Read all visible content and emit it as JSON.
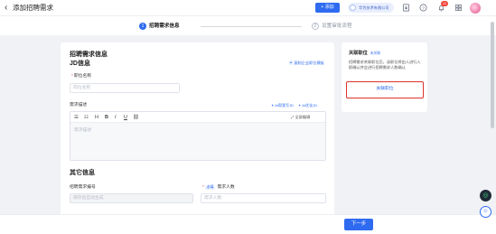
{
  "header": {
    "back_icon": "chevron-left-icon",
    "title": "添加招聘需求",
    "add_button": "+ 添加",
    "user_pill": "华为技术有限公司",
    "notification_count": "11"
  },
  "steps": [
    {
      "number": "1",
      "label": "招聘需求信息"
    },
    {
      "number": "2",
      "label": "设置审批流程"
    }
  ],
  "form": {
    "section_title": "招聘需求信息",
    "jd_title": "JD信息",
    "copy_link": "复制企业职位模板",
    "position_label": "职位名称",
    "position_placeholder": "岗位名称",
    "desc_label": "需求描述",
    "ai_generate": "AI帮我写JD",
    "optimize": "AI优化JD",
    "fullscreen": "全屏编辑",
    "desc_placeholder": "需求描述",
    "other_title": "其它信息",
    "code_label": "招聘需求编号",
    "code_placeholder": "保存后自动生成",
    "headcount_tag": "必填",
    "headcount_label": "需求人数",
    "headcount_placeholder": "需求人数"
  },
  "sidebar": {
    "title": "关联职位",
    "tag": "未关联",
    "description": "招聘需求关联职位后，该职位将由人进行入职确认并会进行招聘需求人数确认",
    "button": "关联职位"
  },
  "footer": {
    "next_button": "下一步"
  }
}
